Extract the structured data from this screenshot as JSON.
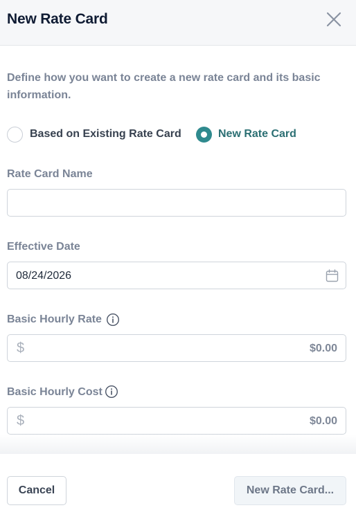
{
  "dialog": {
    "title": "New Rate Card",
    "description": "Define how you want to create a new rate card and its basic information."
  },
  "mode_options": [
    {
      "label": "Based on Existing Rate Card",
      "selected": false
    },
    {
      "label": "New Rate Card",
      "selected": true
    }
  ],
  "fields": {
    "rate_card_name": {
      "label": "Rate Card Name",
      "value": ""
    },
    "effective_date": {
      "label": "Effective Date",
      "value": "08/24/2026"
    },
    "basic_hourly_rate": {
      "label": "Basic Hourly Rate",
      "currency_symbol": "$",
      "value": "$0.00"
    },
    "basic_hourly_cost": {
      "label": "Basic Hourly Cost",
      "currency_symbol": "$",
      "value": "$0.00"
    }
  },
  "footer": {
    "cancel_label": "Cancel",
    "create_label": "New Rate Card..."
  },
  "icons": {
    "close": "close-icon",
    "calendar": "calendar-icon",
    "info": "info-icon"
  },
  "colors": {
    "accent": "#2f8a8e",
    "title": "#0f1b33",
    "muted_text": "#7a8496",
    "border": "#cfd4db"
  }
}
